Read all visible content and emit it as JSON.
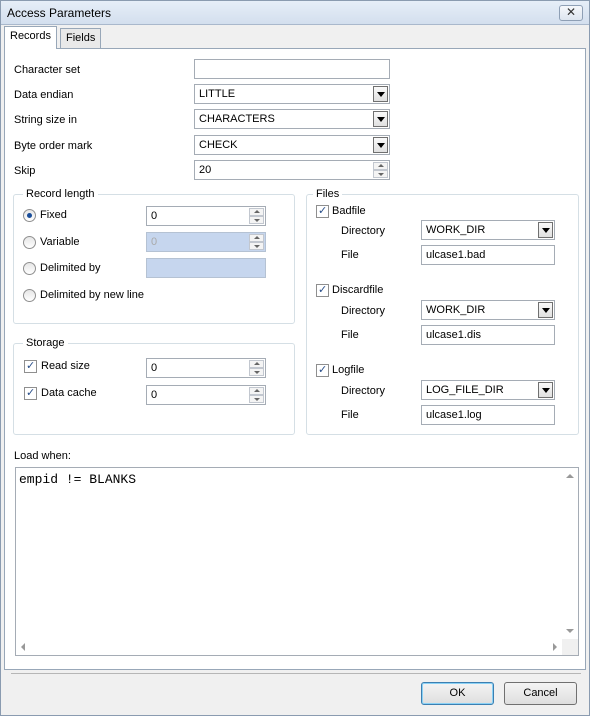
{
  "window": {
    "title": "Access Parameters",
    "close_glyph": "✕"
  },
  "tabs": [
    {
      "label": "Records",
      "active": true
    },
    {
      "label": "Fields",
      "active": false
    }
  ],
  "records": {
    "character_set": {
      "label": "Character set",
      "value": ""
    },
    "data_endian": {
      "label": "Data endian",
      "value": "LITTLE"
    },
    "string_size_in": {
      "label": "String size in",
      "value": "CHARACTERS"
    },
    "byte_order_mark": {
      "label": "Byte order mark",
      "value": "CHECK"
    },
    "skip": {
      "label": "Skip",
      "value": "20"
    }
  },
  "record_length": {
    "title": "Record length",
    "fixed": {
      "label": "Fixed",
      "value": "0",
      "selected": true
    },
    "variable": {
      "label": "Variable",
      "value": "0",
      "selected": false
    },
    "delimited_by": {
      "label": "Delimited by",
      "value": "",
      "selected": false
    },
    "delimited_newline": {
      "label": "Delimited by new line",
      "selected": false
    }
  },
  "storage": {
    "title": "Storage",
    "read_size": {
      "label": "Read size",
      "value": "0",
      "checked": true
    },
    "data_cache": {
      "label": "Data cache",
      "value": "0",
      "checked": true
    }
  },
  "files": {
    "title": "Files",
    "directory_label": "Directory",
    "file_label": "File",
    "badfile": {
      "label": "Badfile",
      "checked": true,
      "directory": "WORK_DIR",
      "file": "ulcase1.bad"
    },
    "discardfile": {
      "label": "Discardfile",
      "checked": true,
      "directory": "WORK_DIR",
      "file": "ulcase1.dis"
    },
    "logfile": {
      "label": "Logfile",
      "checked": true,
      "directory": "LOG_FILE_DIR",
      "file": "ulcase1.log"
    }
  },
  "load_when": {
    "label": "Load when:",
    "value": "empid != BLANKS"
  },
  "buttons": {
    "ok": "OK",
    "cancel": "Cancel"
  }
}
